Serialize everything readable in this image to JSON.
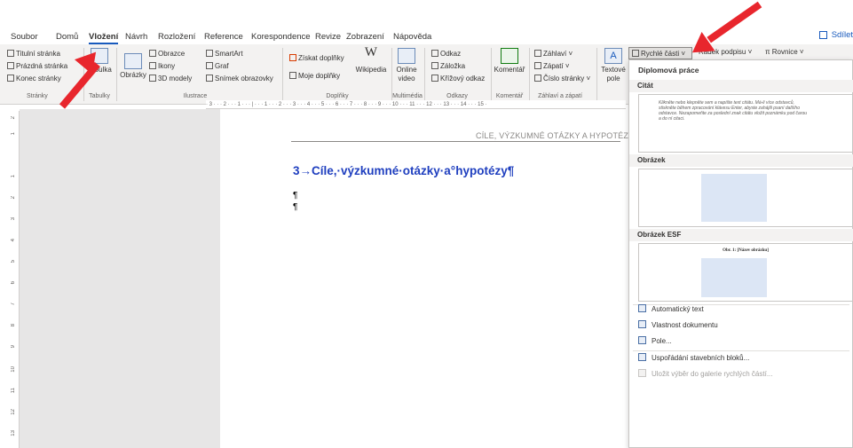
{
  "tabs": [
    "Soubor",
    "Domů",
    "Vložení",
    "Návrh",
    "Rozložení",
    "Reference",
    "Korespondence",
    "Revize",
    "Zobrazení",
    "Nápověda"
  ],
  "active_tab": "Vložení",
  "share_label": "Sdílet",
  "ribbon": {
    "pages": {
      "items": [
        "Titulní stránka",
        "Prázdná stránka",
        "Konec stránky"
      ],
      "label": "Stránky"
    },
    "tables": {
      "button": "Tabulka",
      "label": "Tabulky"
    },
    "illustrations": {
      "pictures": "Obrázky",
      "items": [
        "Obrazce",
        "Ikony",
        "3D modely"
      ],
      "items2": [
        "SmartArt",
        "Graf",
        "Snímek obrazovky"
      ],
      "label": "Ilustrace"
    },
    "addins": {
      "items": [
        "Získat doplňky",
        "Moje doplňky"
      ],
      "wikipedia": "Wikipedia",
      "label": "Doplňky"
    },
    "media": {
      "button": "Online video",
      "label": "Multimédia"
    },
    "links": {
      "items": [
        "Odkaz",
        "Záložka",
        "Křížový odkaz"
      ],
      "label": "Odkazy"
    },
    "comments": {
      "button": "Komentář",
      "label": "Komentář"
    },
    "header_footer": {
      "items": [
        "Záhlaví",
        "Zápatí",
        "Číslo stránky"
      ],
      "label": "Záhlaví a zápatí"
    },
    "text": {
      "textbox": "Textové pole",
      "quick_parts": "Rychlé části",
      "signature": "Řádek podpisu",
      "equation": "Rovnice"
    }
  },
  "document": {
    "header_text": "CÍLE, VÝZKUMNÉ OTÁZKY A HYPOTÉZY¶",
    "heading": "3→Cíle,·výzkumné·otázky·a°hypotézy¶",
    "para1": "¶",
    "para2": "¶"
  },
  "dropdown": {
    "title": "Diplomová práce",
    "sections": [
      "Citát",
      "Obrázek",
      "Obrázek ESF"
    ],
    "quote_text": "Klikněte nebo klepněte sem a napište text citátu. Má-li více odstavců, stiskněte během zpracování klávesu Enter, abyste zahájili psaní dalšího odstavce. Nezapomeňte za poslední znak citátu vložit poznámku pod čarou a do ní citaci.",
    "esf_caption": "Obr. 1: [Název obrázku]",
    "menu": [
      "Automatický text",
      "Vlastnost dokumentu",
      "Pole...",
      "Uspořádání stavebních bloků...",
      "Uložit výběr do galerie rychlých částí..."
    ]
  },
  "ruler_text": "· 3 · · · 2 · · · 1 · · · | · · · 1 · · · 2 · · · 3 · · · 4 · · · 5 · · · 6 · · · 7 · · · 8 · · · 9 · · · 10 · · · 11 · · · 12 · · · 13 · · · 14 · · · 15 ·",
  "vruler_numbers": [
    "2",
    "1",
    "1",
    "2",
    "3",
    "4",
    "5",
    "6",
    "7",
    "8",
    "9",
    "10",
    "11",
    "12",
    "13"
  ],
  "colors": {
    "accent": "#185abd",
    "heading": "#1f3fbf",
    "arrow": "#e8262d"
  }
}
